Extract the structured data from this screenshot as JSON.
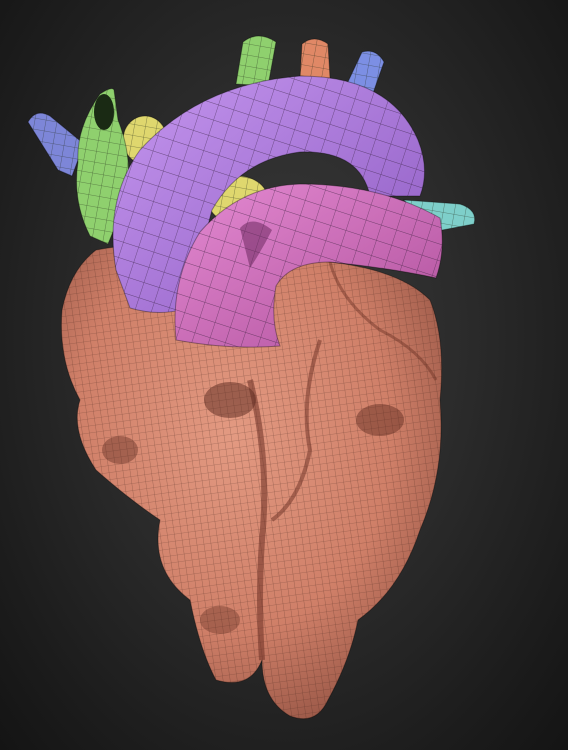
{
  "scene": {
    "subject": "heart-mesh",
    "palette": {
      "background_center": "#3a3a3a",
      "background_edge": "#141414",
      "myocardium": "#d98a73",
      "aorta": "#b07ee0",
      "pulmonary_artery": "#d672c4",
      "svc_green": "#8fd06e",
      "left_blue": "#7d86d8",
      "right_blue": "#7c8fe4",
      "top_orange": "#e08866",
      "yellow": "#dfd76e",
      "teal": "#7ecfca",
      "wire": "#2a1a18"
    }
  }
}
